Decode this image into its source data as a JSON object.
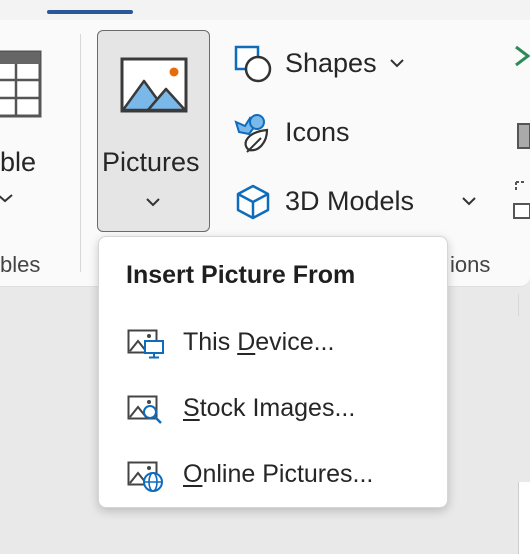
{
  "ribbon": {
    "table": {
      "label_fragment": "ble",
      "group_fragment": "bles"
    },
    "pictures": {
      "label": "Pictures"
    },
    "shapes": {
      "label": "Shapes"
    },
    "icons": {
      "label": "Icons"
    },
    "models3d": {
      "label": "3D Models"
    },
    "illustrations": {
      "group_fragment": "ions"
    }
  },
  "dropdown": {
    "header": "Insert Picture From",
    "items": [
      {
        "pre": "This ",
        "accel": "D",
        "post": "evice...",
        "icon": "picture-device-icon"
      },
      {
        "pre": "",
        "accel": "S",
        "post": "tock Images...",
        "icon": "picture-search-icon"
      },
      {
        "pre": "",
        "accel": "O",
        "post": "nline Pictures...",
        "icon": "picture-online-icon"
      }
    ]
  },
  "colors": {
    "accent": "#2b579a",
    "icon_blue": "#0f6cbd",
    "picture_blue": "#7ab8ea",
    "sun_orange": "#e46c0a"
  }
}
